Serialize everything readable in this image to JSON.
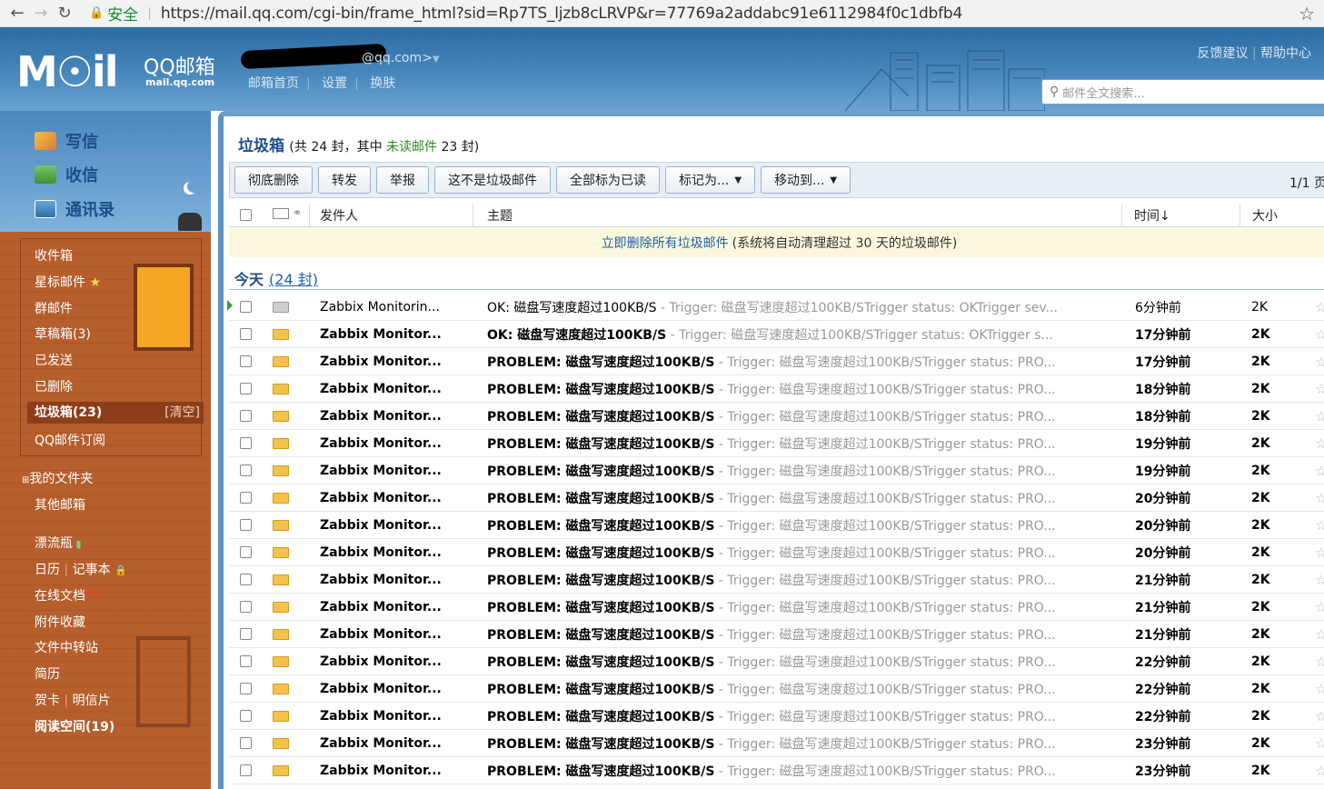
{
  "browser": {
    "secure_label": "安全",
    "url": "https://mail.qq.com/cgi-bin/frame_html?sid=Rp7TS_ljzb8cLRVP&r=77769a2addabc91e6112984f0c1dbfb4"
  },
  "header": {
    "logo": "M☉il",
    "logo_cn": "QQ邮箱",
    "logo_domain": "mail.qq.com",
    "account_suffix": "@qq.com>",
    "links": [
      "邮箱首页",
      "设置",
      "换肤"
    ],
    "feedback": "反馈建议",
    "help": "帮助中心",
    "search_placeholder": "邮件全文搜索..."
  },
  "actions": {
    "compose": "写信",
    "receive": "收信",
    "contacts": "通讯录"
  },
  "sidebar": {
    "items": [
      {
        "label": "收件箱"
      },
      {
        "label": "星标邮件"
      },
      {
        "label": "群邮件"
      },
      {
        "label": "草稿箱(3)"
      },
      {
        "label": "已发送"
      },
      {
        "label": "已删除"
      },
      {
        "label": "垃圾箱(23)",
        "extra": "[清空]"
      },
      {
        "label": "QQ邮件订阅"
      },
      {
        "label": "我的文件夹"
      },
      {
        "label": "其他邮箱"
      },
      {
        "label": "漂流瓶"
      },
      {
        "label": "日历"
      },
      {
        "label": "记事本"
      },
      {
        "label": "在线文档"
      },
      {
        "label": "附件收藏"
      },
      {
        "label": "文件中转站"
      },
      {
        "label": "简历"
      },
      {
        "label": "贺卡"
      },
      {
        "label": "明信片"
      },
      {
        "label": "阅读空间(19)"
      }
    ],
    "new_badge": "NEW"
  },
  "main": {
    "title": "垃圾箱",
    "summary_pre": "(共 24 封，其中 ",
    "summary_unread": "未读邮件",
    "summary_post": " 23 封)",
    "toolbar": [
      "彻底删除",
      "转发",
      "举报",
      "这不是垃圾邮件",
      "全部标为已读",
      "标记为...",
      "移动到..."
    ],
    "pager": "1/1 页",
    "columns": {
      "from": "发件人",
      "subject": "主题",
      "time": "时间↓",
      "size": "大小"
    },
    "notice_link": "立即删除所有垃圾邮件",
    "notice_text": "(系统将自动清理超过 30 天的垃圾邮件)",
    "group_label": "今天",
    "group_count": "(24 封)",
    "emails": [
      {
        "from": "Zabbix Monitorin...",
        "subject": "OK: 磁盘写速度超过100KB/S",
        "preview": " - Trigger: 磁盘写速度超过100KB/STrigger status: OKTrigger sev...",
        "time": "6分钟前",
        "size": "2K",
        "read": true
      },
      {
        "from": "Zabbix Monitor...",
        "subject": "OK: 磁盘写速度超过100KB/S",
        "preview": " - Trigger: 磁盘写速度超过100KB/STrigger status: OKTrigger s...",
        "time": "17分钟前",
        "size": "2K",
        "read": false
      },
      {
        "from": "Zabbix Monitor...",
        "subject": "PROBLEM: 磁盘写速度超过100KB/S",
        "preview": " - Trigger: 磁盘写速度超过100KB/STrigger status: PRO...",
        "time": "17分钟前",
        "size": "2K",
        "read": false
      },
      {
        "from": "Zabbix Monitor...",
        "subject": "PROBLEM: 磁盘写速度超过100KB/S",
        "preview": " - Trigger: 磁盘写速度超过100KB/STrigger status: PRO...",
        "time": "18分钟前",
        "size": "2K",
        "read": false
      },
      {
        "from": "Zabbix Monitor...",
        "subject": "PROBLEM: 磁盘写速度超过100KB/S",
        "preview": " - Trigger: 磁盘写速度超过100KB/STrigger status: PRO...",
        "time": "18分钟前",
        "size": "2K",
        "read": false
      },
      {
        "from": "Zabbix Monitor...",
        "subject": "PROBLEM: 磁盘写速度超过100KB/S",
        "preview": " - Trigger: 磁盘写速度超过100KB/STrigger status: PRO...",
        "time": "19分钟前",
        "size": "2K",
        "read": false
      },
      {
        "from": "Zabbix Monitor...",
        "subject": "PROBLEM: 磁盘写速度超过100KB/S",
        "preview": " - Trigger: 磁盘写速度超过100KB/STrigger status: PRO...",
        "time": "19分钟前",
        "size": "2K",
        "read": false
      },
      {
        "from": "Zabbix Monitor...",
        "subject": "PROBLEM: 磁盘写速度超过100KB/S",
        "preview": " - Trigger: 磁盘写速度超过100KB/STrigger status: PRO...",
        "time": "20分钟前",
        "size": "2K",
        "read": false
      },
      {
        "from": "Zabbix Monitor...",
        "subject": "PROBLEM: 磁盘写速度超过100KB/S",
        "preview": " - Trigger: 磁盘写速度超过100KB/STrigger status: PRO...",
        "time": "20分钟前",
        "size": "2K",
        "read": false
      },
      {
        "from": "Zabbix Monitor...",
        "subject": "PROBLEM: 磁盘写速度超过100KB/S",
        "preview": " - Trigger: 磁盘写速度超过100KB/STrigger status: PRO...",
        "time": "20分钟前",
        "size": "2K",
        "read": false
      },
      {
        "from": "Zabbix Monitor...",
        "subject": "PROBLEM: 磁盘写速度超过100KB/S",
        "preview": " - Trigger: 磁盘写速度超过100KB/STrigger status: PRO...",
        "time": "21分钟前",
        "size": "2K",
        "read": false
      },
      {
        "from": "Zabbix Monitor...",
        "subject": "PROBLEM: 磁盘写速度超过100KB/S",
        "preview": " - Trigger: 磁盘写速度超过100KB/STrigger status: PRO...",
        "time": "21分钟前",
        "size": "2K",
        "read": false
      },
      {
        "from": "Zabbix Monitor...",
        "subject": "PROBLEM: 磁盘写速度超过100KB/S",
        "preview": " - Trigger: 磁盘写速度超过100KB/STrigger status: PRO...",
        "time": "21分钟前",
        "size": "2K",
        "read": false
      },
      {
        "from": "Zabbix Monitor...",
        "subject": "PROBLEM: 磁盘写速度超过100KB/S",
        "preview": " - Trigger: 磁盘写速度超过100KB/STrigger status: PRO...",
        "time": "22分钟前",
        "size": "2K",
        "read": false
      },
      {
        "from": "Zabbix Monitor...",
        "subject": "PROBLEM: 磁盘写速度超过100KB/S",
        "preview": " - Trigger: 磁盘写速度超过100KB/STrigger status: PRO...",
        "time": "22分钟前",
        "size": "2K",
        "read": false
      },
      {
        "from": "Zabbix Monitor...",
        "subject": "PROBLEM: 磁盘写速度超过100KB/S",
        "preview": " - Trigger: 磁盘写速度超过100KB/STrigger status: PRO...",
        "time": "22分钟前",
        "size": "2K",
        "read": false
      },
      {
        "from": "Zabbix Monitor...",
        "subject": "PROBLEM: 磁盘写速度超过100KB/S",
        "preview": " - Trigger: 磁盘写速度超过100KB/STrigger status: PRO...",
        "time": "23分钟前",
        "size": "2K",
        "read": false
      },
      {
        "from": "Zabbix Monitor...",
        "subject": "PROBLEM: 磁盘写速度超过100KB/S",
        "preview": " - Trigger: 磁盘写速度超过100KB/STrigger status: PRO...",
        "time": "23分钟前",
        "size": "2K",
        "read": false
      }
    ]
  },
  "colors": {
    "header_blue": "#2f6fa6",
    "wall_brick": "#b65e2c",
    "unread_green": "#2a8c1a",
    "link_blue": "#1f5fa6",
    "envelope_unread": "#f3c24a",
    "envelope_read": "#cfcfcf"
  },
  "icons": {
    "back": "back-arrow-icon",
    "forward": "forward-arrow-icon",
    "reload": "reload-icon",
    "lock": "lock-icon",
    "bookmark": "star-icon",
    "search": "search-icon",
    "envelope": "envelope-icon",
    "flag": "star-icon"
  }
}
